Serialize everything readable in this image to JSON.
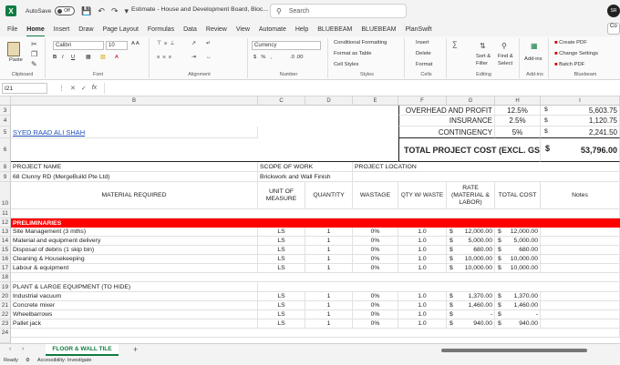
{
  "titlebar": {
    "autosave_label": "AutoSave",
    "autosave_state": "Off",
    "doc_title": "Estimate - House and Development Board, Bloc...",
    "search_placeholder": "Search",
    "avatar_initials": "SR"
  },
  "menu": {
    "tabs": [
      "File",
      "Home",
      "Insert",
      "Draw",
      "Page Layout",
      "Formulas",
      "Data",
      "Review",
      "View",
      "Automate",
      "Help",
      "BLUEBEAM",
      "BLUEBEAM",
      "PlanSwift"
    ],
    "active": "Home"
  },
  "ribbon": {
    "clipboard": {
      "paste": "Paste",
      "label": "Clipboard"
    },
    "font": {
      "name": "Calibri",
      "size": "10",
      "label": "Font"
    },
    "alignment": {
      "label": "Alignment"
    },
    "number": {
      "format": "Currency",
      "label": "Number"
    },
    "styles": {
      "conditional": "Conditional Formatting",
      "table": "Format as Table",
      "cell": "Cell Styles",
      "label": "Styles"
    },
    "cells": {
      "insert": "Insert",
      "delete": "Delete",
      "format": "Format",
      "label": "Cells"
    },
    "editing": {
      "sort": "Sort &",
      "filter": "Filter",
      "find": "Find &",
      "select": "Select",
      "label": "Editing"
    },
    "addins": {
      "addins": "Add-ins",
      "label": "Add-ins"
    },
    "bluebeam": {
      "create": "Create PDF",
      "change": "Change Settings",
      "batch": "Batch PDF",
      "label": "Bluebeam"
    }
  },
  "formula_bar": {
    "name_box": "I21",
    "fx": "fx"
  },
  "columns": [
    "B",
    "C",
    "D",
    "E",
    "F",
    "G",
    "H",
    "I"
  ],
  "summary": {
    "overhead_label": "OVERHEAD AND PROFIT",
    "overhead_pct": "12.5%",
    "overhead_amt": "5,603.75",
    "insurance_label": "INSURANCE",
    "insurance_pct": "2.5%",
    "insurance_amt": "1,120.75",
    "contingency_label": "CONTINGENCY",
    "contingency_pct": "5%",
    "contingency_amt": "2,241.50",
    "total_label": "TOTAL PROJECT COST (EXCL. GST)",
    "total_amt": "53,796.00",
    "currency": "$"
  },
  "author": "SYED RAAD ALI SHAH",
  "project": {
    "name_label": "PROJECT NAME",
    "name_value": "68 Clunny RD (MergeBuild Pte Ltd)",
    "scope_label": "SCOPE OF WORK",
    "scope_value": "Brickwork and Wall Finish",
    "location_label": "PROJECT LOCATION"
  },
  "headers": {
    "material": "MATERIAL REQUIRED",
    "unit": "UNIT OF MEASURE",
    "qty": "QUANTITY",
    "wastage": "WASTAGE",
    "qtyw": "QTY W/ WASTE",
    "rate": "RATE (MATERIAL & LABOR)",
    "total": "TOTAL COST",
    "notes": "Notes"
  },
  "section1": "PRELIMINARIES",
  "section2": "PLANT & LARGE EQUIPMENT (TO HIDE)",
  "rows_prelim": [
    {
      "row": "13",
      "item": "Site Management (3 mths)",
      "unit": "LS",
      "qty": "1",
      "waste": "0%",
      "qtyw": "1.0",
      "rate": "12,000.00",
      "total": "12,000.00"
    },
    {
      "row": "14",
      "item": "Material and equipment delivery",
      "unit": "LS",
      "qty": "1",
      "waste": "0%",
      "qtyw": "1.0",
      "rate": "5,000.00",
      "total": "5,000.00"
    },
    {
      "row": "15",
      "item": "Disposal of debris (1 skip bin)",
      "unit": "LS",
      "qty": "1",
      "waste": "0%",
      "qtyw": "1.0",
      "rate": "680.00",
      "total": "680.00"
    },
    {
      "row": "16",
      "item": "Cleaning & Housekeeping",
      "unit": "LS",
      "qty": "1",
      "waste": "0%",
      "qtyw": "1.0",
      "rate": "10,000.00",
      "total": "10,000.00"
    },
    {
      "row": "17",
      "item": "Labour & equipment",
      "unit": "LS",
      "qty": "1",
      "waste": "0%",
      "qtyw": "1.0",
      "rate": "10,000.00",
      "total": "10,000.00"
    }
  ],
  "rows_plant": [
    {
      "row": "20",
      "item": "Industrial vacuum",
      "unit": "LS",
      "qty": "1",
      "waste": "0%",
      "qtyw": "1.0",
      "rate": "1,370.00",
      "total": "1,370.00"
    },
    {
      "row": "21",
      "item": "Concrete mixer",
      "unit": "LS",
      "qty": "1",
      "waste": "0%",
      "qtyw": "1.0",
      "rate": "1,460.00",
      "total": "1,460.00"
    },
    {
      "row": "22",
      "item": "Wheelbarrows",
      "unit": "LS",
      "qty": "1",
      "waste": "0%",
      "qtyw": "1.0",
      "rate": "-",
      "total": "-"
    },
    {
      "row": "23",
      "item": "Pallet jack",
      "unit": "LS",
      "qty": "1",
      "waste": "0%",
      "qtyw": "1.0",
      "rate": "940.00",
      "total": "940.00"
    }
  ],
  "row_numbers": {
    "r3": "3",
    "r4": "4",
    "r5": "5",
    "r6": "6",
    "r7": "7",
    "r8": "8",
    "r9": "9",
    "r10": "10",
    "r11": "11",
    "r12": "12",
    "r18": "18",
    "r19": "19",
    "r24": "24"
  },
  "sheet": {
    "tab": "FLOOR & WALL TILE",
    "add": "+"
  },
  "status": {
    "ready": "Ready",
    "accessibility": "Accessibility: Investigate"
  }
}
